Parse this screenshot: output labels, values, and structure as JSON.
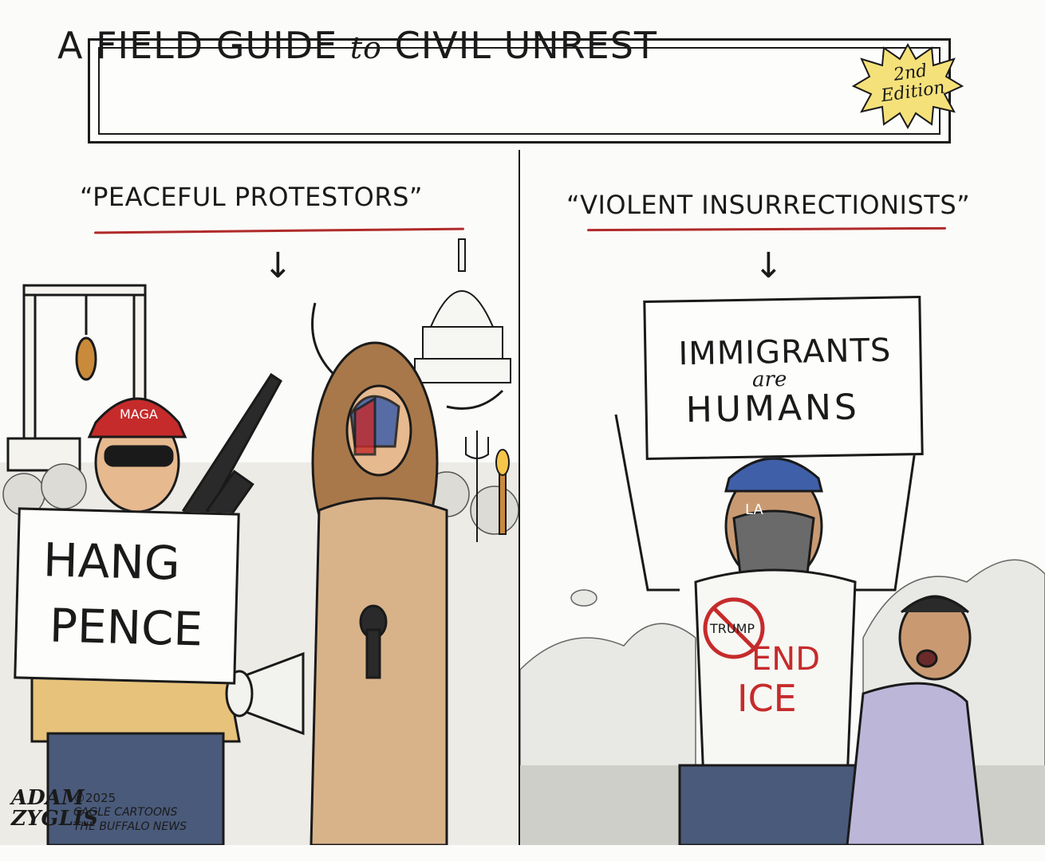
{
  "title": {
    "part1": "A FIELD GUIDE ",
    "part2": "to",
    "part3": " CIVIL UNREST",
    "edition_line1": "2nd",
    "edition_line2": "Edition"
  },
  "left_panel": {
    "caption": "“PEACEFUL PROTESTORS”",
    "arrow": "↓",
    "sign_line1": "HANG",
    "sign_line2": "PENCE",
    "hat_text": "MAGA"
  },
  "right_panel": {
    "caption": "“VIOLENT INSURRECTIONISTS”",
    "arrow": "↓",
    "sign_line1": "IMMIGRANTS",
    "sign_line2": "are",
    "sign_line3": "HUMANS",
    "cap_text": "LA",
    "button_text": "TRUMP",
    "shirt_line1": "END",
    "shirt_line2": "ICE"
  },
  "credit": {
    "signature_line1": "ADAM",
    "signature_line2": "ZYGLIS",
    "copyright": "©2025",
    "syndicate": "CAGLE CARTOONS",
    "newspaper": "THE BUFFALO NEWS"
  },
  "colors": {
    "ink": "#1a1a1a",
    "paper": "#fbfbf9",
    "accent_red": "#b02a2a",
    "burst_yellow": "#f5e17a",
    "cap_blue": "#3f5fa8",
    "skin": "#e6b98f",
    "fur": "#a8784a"
  }
}
